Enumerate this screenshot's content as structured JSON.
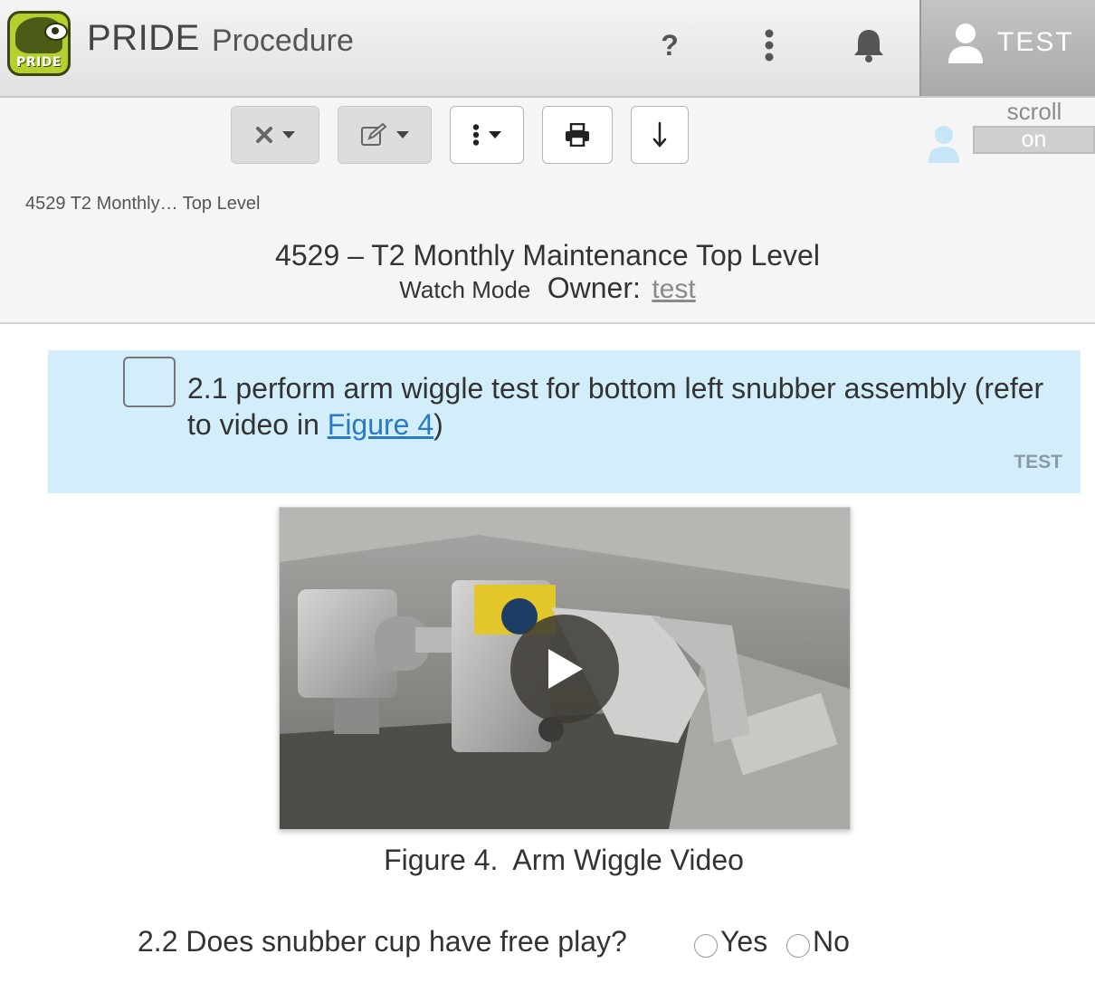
{
  "header": {
    "logo_text": "PRIDE",
    "app_name": "PRIDE",
    "app_subtitle": "Procedure",
    "help_glyph": "?",
    "icons": [
      "help-icon",
      "more-vertical-icon",
      "bell-icon",
      "user-icon"
    ],
    "user_name": "TEST"
  },
  "toolbar": {
    "buttons": [
      {
        "name": "close-dropdown-button",
        "icon": "close-icon"
      },
      {
        "name": "edit-dropdown-button",
        "icon": "edit-icon"
      },
      {
        "name": "more-dropdown-button",
        "icon": "more-vertical-icon"
      },
      {
        "name": "print-button",
        "icon": "print-icon"
      },
      {
        "name": "download-button",
        "icon": "arrow-down-icon"
      }
    ],
    "scroll_label": "scroll",
    "scroll_state": "on"
  },
  "breadcrumb": "4529 T2 Monthly… Top Level",
  "procedure": {
    "title": "4529 – T2 Monthly Maintenance Top Level",
    "mode": "Watch Mode",
    "owner_label": "Owner:",
    "owner": "test"
  },
  "step": {
    "text_before": "2.1 perform arm wiggle test for bottom left snubber assembly (refer to video in ",
    "link": "Figure 4",
    "text_after": ")",
    "user": "TEST",
    "highlight_color": "#d2eefb"
  },
  "figure": {
    "caption": "Figure 4.  Arm Wiggle Video"
  },
  "question": {
    "text": "2.2 Does snubber cup have free play?",
    "options": [
      "Yes",
      "No"
    ]
  },
  "colors": {
    "link": "#2a7ac4",
    "logo_green": "#b5cf2c",
    "user_panel": "#b5b5b5"
  }
}
